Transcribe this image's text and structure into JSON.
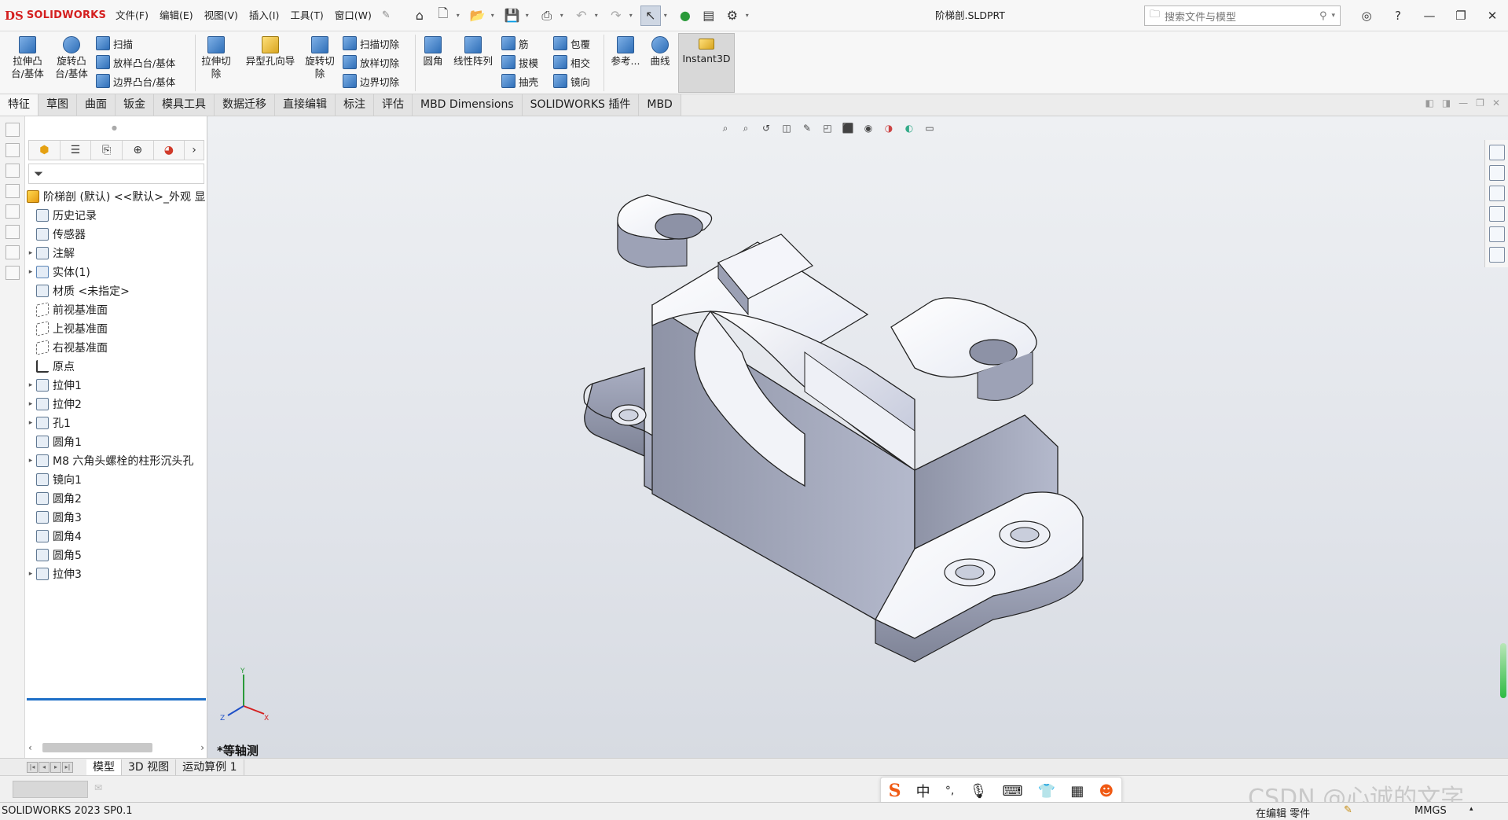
{
  "app": {
    "logo_ds": "DS",
    "logo_name": "SOLIDWORKS",
    "window_title": "阶梯剖.SLDPRT"
  },
  "menu": [
    "文件(F)",
    "编辑(E)",
    "视图(V)",
    "插入(I)",
    "工具(T)",
    "窗口(W)"
  ],
  "search": {
    "placeholder": "搜索文件与模型"
  },
  "ribbon": {
    "extrude_boss": "拉伸凸台/基体",
    "revolve_boss": "旋转凸台/基体",
    "sweep": "扫描",
    "loft_boss": "放样凸台/基体",
    "boundary_boss": "边界凸台/基体",
    "extrude_cut": "拉伸切除",
    "hole_wizard": "异型孔向导",
    "revolve_cut": "旋转切除",
    "swept_cut": "扫描切除",
    "lofted_cut": "放样切除",
    "boundary_cut": "边界切除",
    "fillet": "圆角",
    "linear_pattern": "线性阵列",
    "rib": "筋",
    "draft": "拔模",
    "shell": "抽壳",
    "wrap": "包覆",
    "intersect": "相交",
    "mirror": "镜向",
    "reference": "参考...",
    "curves": "曲线",
    "instant3d": "Instant3D"
  },
  "tabs": [
    "特征",
    "草图",
    "曲面",
    "钣金",
    "模具工具",
    "数据迁移",
    "直接编辑",
    "标注",
    "评估",
    "MBD Dimensions",
    "SOLIDWORKS 插件",
    "MBD"
  ],
  "tree": {
    "root": "阶梯剖 (默认) <<默认>_外观 显",
    "items": [
      {
        "label": "历史记录",
        "arrow": ""
      },
      {
        "label": "传感器",
        "arrow": ""
      },
      {
        "label": "注解",
        "arrow": "▸"
      },
      {
        "label": "实体(1)",
        "arrow": "▸"
      },
      {
        "label": "材质 <未指定>",
        "arrow": ""
      },
      {
        "label": "前视基准面",
        "arrow": ""
      },
      {
        "label": "上视基准面",
        "arrow": ""
      },
      {
        "label": "右视基准面",
        "arrow": ""
      },
      {
        "label": "原点",
        "arrow": ""
      },
      {
        "label": "拉伸1",
        "arrow": "▸"
      },
      {
        "label": "拉伸2",
        "arrow": "▸"
      },
      {
        "label": "孔1",
        "arrow": "▸"
      },
      {
        "label": "圆角1",
        "arrow": ""
      },
      {
        "label": "M8 六角头螺栓的柱形沉头孔",
        "arrow": "▸"
      },
      {
        "label": "镜向1",
        "arrow": ""
      },
      {
        "label": "圆角2",
        "arrow": ""
      },
      {
        "label": "圆角3",
        "arrow": ""
      },
      {
        "label": "圆角4",
        "arrow": ""
      },
      {
        "label": "圆角5",
        "arrow": ""
      },
      {
        "label": "拉伸3",
        "arrow": "▸"
      }
    ]
  },
  "viewport": {
    "view_name": "*等轴测",
    "triad_x": "X",
    "triad_y": "Y",
    "triad_z": "Z"
  },
  "bottom_tabs": [
    "模型",
    "3D 视图",
    "运动算例 1"
  ],
  "status": {
    "version": "SOLIDWORKS 2023 SP0.1",
    "mode": "在编辑 零件",
    "units": "MMGS"
  },
  "ime": {
    "logo": "S",
    "lang": "中",
    "punct": "°,"
  },
  "watermark": "CSDN @心诚的文字",
  "colors": {
    "accent": "#1e6fc7",
    "brand_red": "#d42020",
    "active_tab": "#f7f7f7"
  }
}
